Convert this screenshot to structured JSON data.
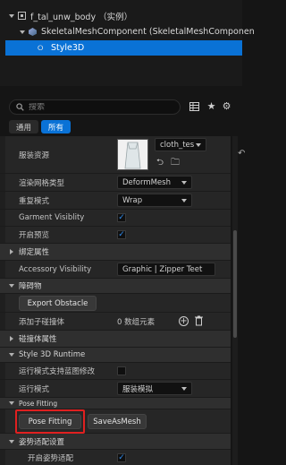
{
  "tree": {
    "root": "f_tal_unw_body （实例）",
    "mesh": "SkeletalMeshComponent (SkeletalMeshComponen",
    "style": "Style3D"
  },
  "search": {
    "placeholder": "搜索"
  },
  "filters": {
    "common": "通用",
    "all": "所有"
  },
  "props": {
    "garment_asset_label": "服装资源",
    "garment_asset_value": "cloth_tes",
    "render_mesh_type_label": "渲染网格类型",
    "render_mesh_type_value": "DeformMesh",
    "repeat_mode_label": "重复模式",
    "repeat_mode_value": "Wrap",
    "garment_visibility_label": "Garment Visiblity",
    "preview_label": "开启预览",
    "binding_attr_label": "绑定属性",
    "accessory_visibility_label": "Accessory Visibility",
    "accessory_visibility_value": "Graphic | Zipper Teet",
    "obstacle_label": "障碍物",
    "export_obstacle": "Export Obstacle",
    "add_collider_label": "添加子碰撞体",
    "add_collider_value": "0 数组元素",
    "collider_attr_label": "碰撞体属性",
    "runtime_label": "Style 3D Runtime",
    "runtime_blueprint_label": "运行模式支持蓝图修改",
    "runtime_mode_label": "运行模式",
    "runtime_mode_value": "服装模拟",
    "pose_fitting_label": "Pose Fitting",
    "pose_fitting_button": "Pose Fitting",
    "save_as_mesh_button": "SaveAsMesh",
    "pose_settings_label": "姿势适配设置",
    "enable_pose_label": "开启姿势适配"
  },
  "colors": {
    "accent": "#0a72d6",
    "highlight": "#e02020",
    "check": "#2f8cf0"
  },
  "icons": [
    "search-icon",
    "table-icon",
    "star-icon",
    "settings-icon",
    "browse-icon",
    "find-asset-icon",
    "add-icon",
    "delete-icon",
    "reset-arrow-icon"
  ]
}
